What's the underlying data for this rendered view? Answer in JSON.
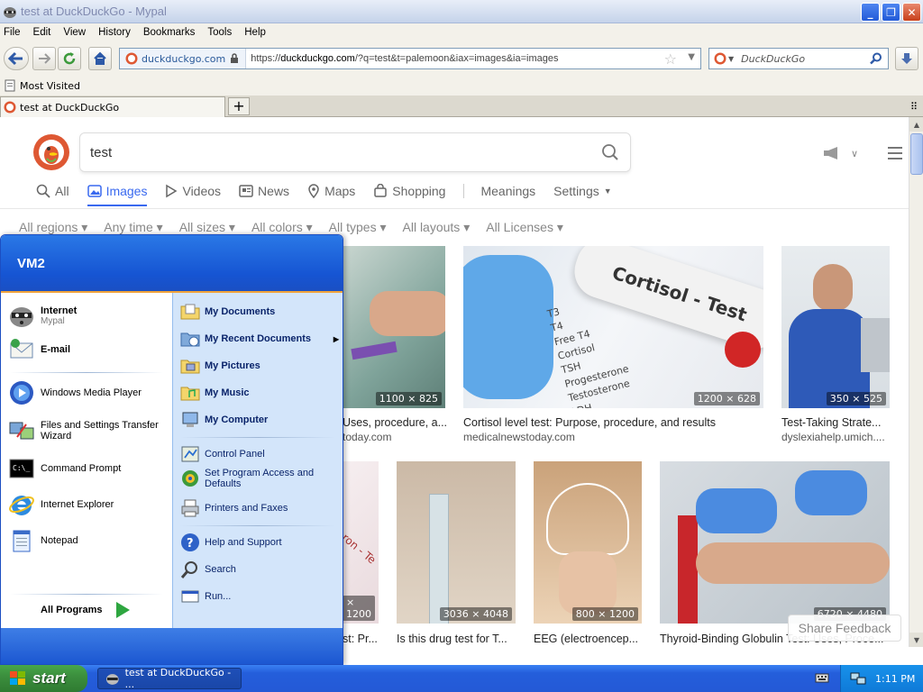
{
  "window": {
    "title": "test at DuckDuckGo - Mypal"
  },
  "menubar": [
    "File",
    "Edit",
    "View",
    "History",
    "Bookmarks",
    "Tools",
    "Help"
  ],
  "navbar": {
    "identity": "duckduckgo.com",
    "url_prefix": "https://",
    "url_host": "duckduckgo.com",
    "url_rest": "/?q=test&t=palemoon&iax=images&ia=images",
    "search_placeholder": "DuckDuckGo"
  },
  "bookmarks": {
    "most_visited": "Most Visited"
  },
  "tabs": [
    {
      "title": "test at DuckDuckGo"
    }
  ],
  "ddg": {
    "query": "test",
    "nav": {
      "all": "All",
      "images": "Images",
      "videos": "Videos",
      "news": "News",
      "maps": "Maps",
      "shopping": "Shopping",
      "meanings": "Meanings",
      "settings": "Settings"
    },
    "filters": [
      "All regions ▾",
      "Any time ▾",
      "All sizes ▾",
      "All colors ▾",
      "All types ▾",
      "All layouts ▾",
      "All Licenses ▾"
    ],
    "row1": [
      {
        "dim": "1100 × 825",
        "caption": "Uses, procedure, a...",
        "source": "today.com"
      },
      {
        "dim": "1200 × 628",
        "caption": "Cortisol level test: Purpose, procedure, and results",
        "source": "medicalnewstoday.com",
        "img_text": "Cortisol - Test",
        "checklist": [
          "T3",
          "T4",
          "Free T4",
          "Cortisol",
          "TSH",
          "Progesterone",
          "Testosterone",
          "LDH"
        ]
      },
      {
        "dim": "350 × 525",
        "caption": "Test-Taking Strate...",
        "source": "dyslexiahelp.umich...."
      }
    ],
    "row2": [
      {
        "dim": "× 1200",
        "caption": "st: Pr...",
        "img_text": "ron - Te"
      },
      {
        "dim": "3036 × 4048",
        "caption": "Is this drug test for T..."
      },
      {
        "dim": "800 × 1200",
        "caption": "EEG (electroencep..."
      },
      {
        "dim": "6720 × 4480",
        "caption": "Thyroid-Binding Globulin Test: Uses, Proce..."
      }
    ],
    "feedback": "Share Feedback"
  },
  "startmenu": {
    "user": "VM2",
    "pinned": [
      {
        "label": "Internet",
        "sub": "Mypal"
      },
      {
        "label": "E-mail"
      }
    ],
    "recent": [
      "Windows Media Player",
      "Files and Settings Transfer Wizard",
      "Command Prompt",
      "Internet Explorer",
      "Notepad"
    ],
    "all_programs": "All Programs",
    "right": {
      "docs": "My Documents",
      "recent_docs": "My Recent Documents",
      "pictures": "My Pictures",
      "music": "My Music",
      "computer": "My Computer",
      "control_panel": "Control Panel",
      "set_program": "Set Program Access and Defaults",
      "printers": "Printers and Faxes",
      "help": "Help and Support",
      "search": "Search",
      "run": "Run..."
    }
  },
  "taskbar": {
    "start": "start",
    "task": "test at DuckDuckGo - ...",
    "clock": "1:11 PM"
  }
}
